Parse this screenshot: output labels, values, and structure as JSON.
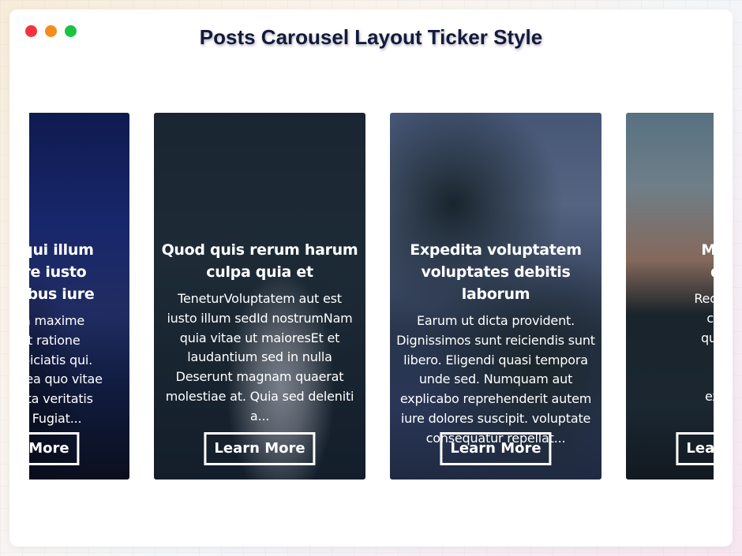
{
  "window": {
    "title": "Posts Carousel Layout Ticker Style"
  },
  "carousel": {
    "cards": [
      {
        "title": "Ratione qui illum\ninventore iusto\nvoluptatibus iure",
        "excerpt": "Dolore non maxime\nut. Quia et ratione\nsit hic perspiciatis qui.\nVoluptatibus ea quo vitae\nsunt expedita veritatis\ninventore. Fugiat...",
        "button": "Learn More"
      },
      {
        "title": "Quod quis rerum harum\nculpa quia et",
        "excerpt": "TeneturVoluptatem aut est\niusto illum sedId nostrumNam\nquia vitae ut maioresEt et\nlaudantium sed in nulla\nDeserunt magnam quaerat\nmolestiae at. Quia sed deleniti\na...",
        "button": "Learn More"
      },
      {
        "title": "Expedita voluptatem\nvoluptates debitis laborum",
        "excerpt": "Earum ut dicta provident.\nDignissimos sunt reiciendis sunt\nlibero. Eligendi quasi tempora\nunde sed. Numquam aut\nexplicabo reprehenderit autem\niure dolores suscipit. voluptate\nconsequatur repellat...",
        "button": "Learn More"
      },
      {
        "title": "Mollitia\ndolor",
        "excerpt": "Recusandae\ncumque\nquo libero\npersp\naccus\nexpedita",
        "button": "Learn More"
      }
    ]
  },
  "colors": {
    "title": "#141a3a",
    "dot_red": "#f4333d",
    "dot_orange": "#f48d1c",
    "dot_green": "#1bc43f"
  }
}
